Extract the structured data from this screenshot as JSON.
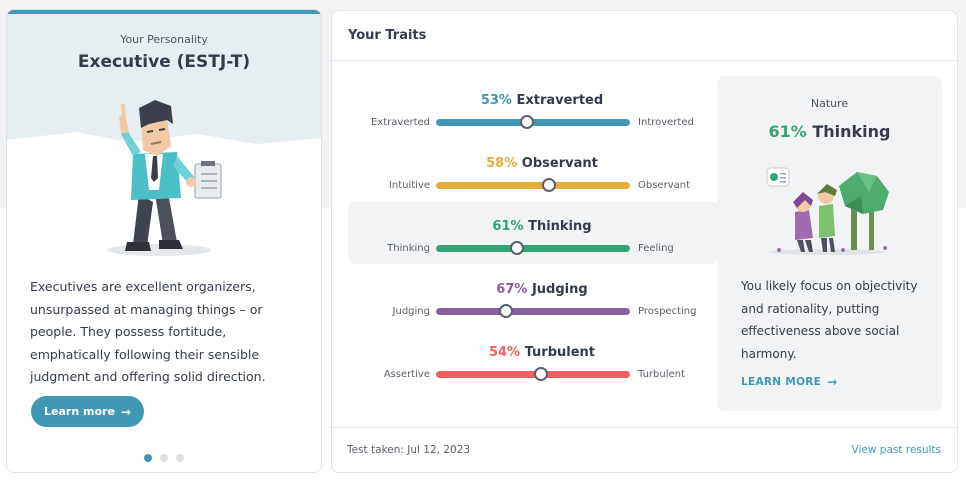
{
  "personality": {
    "eyebrow": "Your Personality",
    "type_title": "Executive (ESTJ-T)",
    "description": "Executives are excellent organizers, unsurpassed at managing things – or people. They possess fortitude, emphatically following their sensible judgment and offering solid direction.",
    "learn_more_label": "Learn more",
    "carousel_total": 3,
    "carousel_active": 1
  },
  "traits": {
    "header": "Your Traits",
    "items": [
      {
        "percent": "53%",
        "trait": "Extraverted",
        "left": "Extraverted",
        "right": "Introverted",
        "color": "#4298b4",
        "position_pct": 47,
        "highlighted": false
      },
      {
        "percent": "58%",
        "trait": "Observant",
        "left": "Intuitive",
        "right": "Observant",
        "color": "#e4ae3a",
        "position_pct": 58,
        "highlighted": false
      },
      {
        "percent": "61%",
        "trait": "Thinking",
        "left": "Thinking",
        "right": "Feeling",
        "color": "#33a474",
        "position_pct": 42,
        "highlighted": true
      },
      {
        "percent": "67%",
        "trait": "Judging",
        "left": "Judging",
        "right": "Prospecting",
        "color": "#88619a",
        "position_pct": 36,
        "highlighted": false
      },
      {
        "percent": "54%",
        "trait": "Turbulent",
        "left": "Assertive",
        "right": "Turbulent",
        "color": "#f25e62",
        "position_pct": 54,
        "highlighted": false
      }
    ],
    "nature": {
      "label": "Nature",
      "percent": "61%",
      "trait": "Thinking",
      "color": "#33a474",
      "description": "You likely focus on objectivity and rationality, putting effectiveness above social harmony.",
      "link_label": "LEARN MORE"
    },
    "footer": {
      "test_taken": "Test taken: Jul 12, 2023",
      "past_results": "View past results"
    }
  },
  "colors": {
    "accent": "#4298b4",
    "thinking": "#33a474"
  }
}
